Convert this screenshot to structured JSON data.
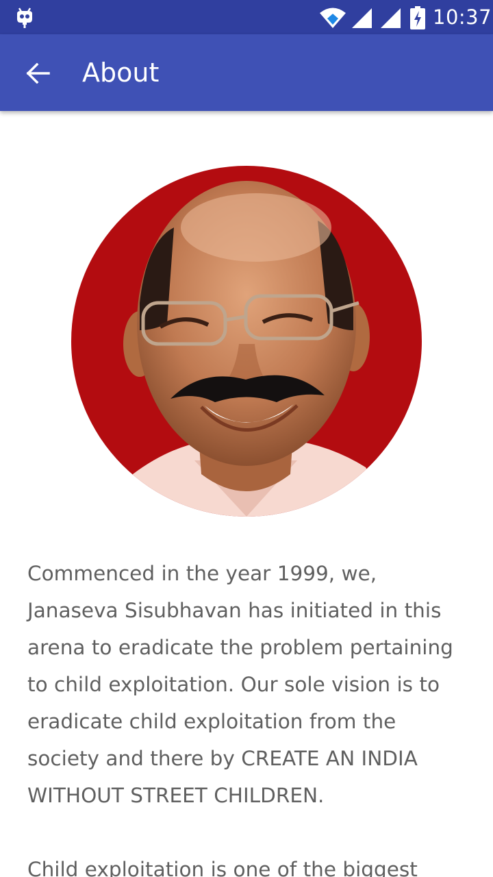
{
  "status_bar": {
    "time": "10:37",
    "icons": [
      "debug-icon",
      "wifi-icon",
      "signal-icon",
      "signal-icon",
      "battery-charging-icon"
    ]
  },
  "app_bar": {
    "title": "About",
    "back_icon": "arrow-back-icon"
  },
  "profile": {
    "image": "portrait-photo",
    "background_color": "#b30c10"
  },
  "paragraphs": [
    "Commenced in the year 1999, we, Janaseva Sisubhavan has initiated in this arena to eradicate the problem pertaining to child exploitation. Our sole vision is to eradicate child exploitation from the society and there by CREATE AN INDIA WITHOUT STREET CHILDREN.",
    "Child exploitation is one of the biggest"
  ],
  "colors": {
    "status_bar": "#303f9f",
    "app_bar": "#3f51b5",
    "body_text": "#5f5f5f"
  }
}
